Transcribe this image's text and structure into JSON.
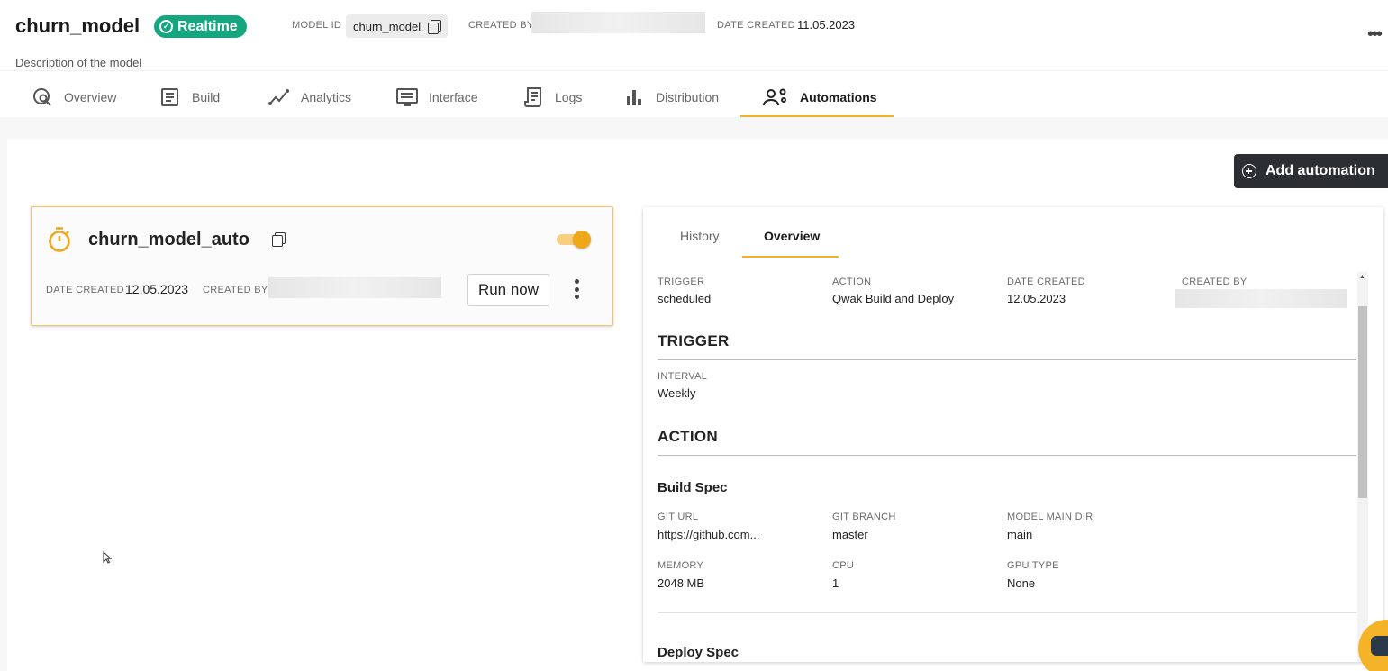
{
  "header": {
    "title": "churn_model",
    "badge": "Realtime",
    "model_id_label": "MODEL ID",
    "model_id": "churn_model",
    "created_by_label": "CREATED BY",
    "date_created_label": "DATE CREATED",
    "date_created": "11.05.2023",
    "description": "Description of the model"
  },
  "tabs": [
    {
      "label": "Overview",
      "icon": "overview-search-icon"
    },
    {
      "label": "Build",
      "icon": "build-document-icon"
    },
    {
      "label": "Analytics",
      "icon": "analytics-chart-icon"
    },
    {
      "label": "Interface",
      "icon": "interface-monitor-icon"
    },
    {
      "label": "Logs",
      "icon": "logs-scroll-icon"
    },
    {
      "label": "Distribution",
      "icon": "distribution-bars-icon"
    },
    {
      "label": "Automations",
      "icon": "automations-user-gear-icon",
      "active": true
    }
  ],
  "toolbar": {
    "add_label": "Add automation"
  },
  "automation": {
    "name": "churn_model_auto",
    "enabled": true,
    "date_created_label": "DATE CREATED",
    "date_created": "12.05.2023",
    "created_by_label": "CREATED BY",
    "run_label": "Run now"
  },
  "details": {
    "tabs": [
      {
        "label": "History"
      },
      {
        "label": "Overview",
        "active": true
      }
    ],
    "summary": [
      {
        "label": "TRIGGER",
        "value": "scheduled"
      },
      {
        "label": "ACTION",
        "value": "Qwak Build and Deploy"
      },
      {
        "label": "DATE CREATED",
        "value": "12.05.2023"
      },
      {
        "label": "CREATED BY",
        "value": ""
      }
    ],
    "trigger_title": "TRIGGER",
    "interval_label": "INTERVAL",
    "interval_value": "Weekly",
    "action_title": "ACTION",
    "build_spec_title": "Build Spec",
    "build_fields": [
      {
        "label": "GIT URL",
        "value": "https://github.com..."
      },
      {
        "label": "GIT BRANCH",
        "value": "master"
      },
      {
        "label": "MODEL MAIN DIR",
        "value": "main"
      },
      {
        "label": "MEMORY",
        "value": "2048 MB"
      },
      {
        "label": "CPU",
        "value": "1"
      },
      {
        "label": "GPU TYPE",
        "value": "None"
      }
    ],
    "deploy_spec_title": "Deploy Spec"
  },
  "colors": {
    "accent": "#f4b329",
    "badge": "#15a57f",
    "dark_button": "#2b2f33"
  }
}
